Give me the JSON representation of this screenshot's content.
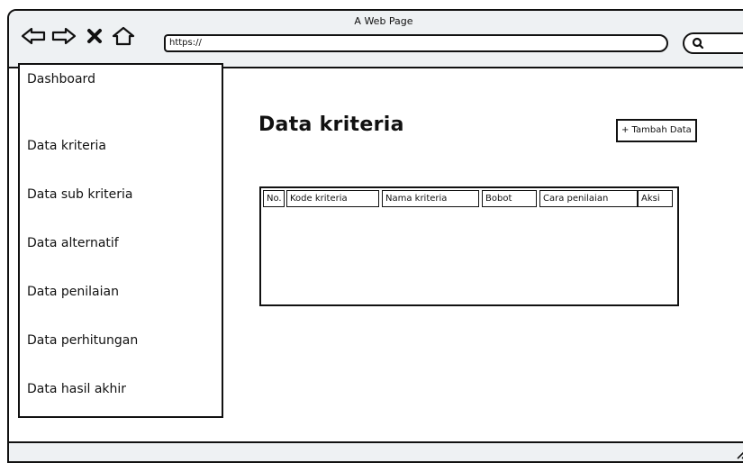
{
  "browser": {
    "title": "A Web Page",
    "url": "https://",
    "icons": [
      "back-arrow-icon",
      "forward-arrow-icon",
      "close-icon",
      "home-icon",
      "search-icon"
    ]
  },
  "sidebar": {
    "items": [
      {
        "label": "Dashboard"
      },
      {
        "label": "Data kriteria"
      },
      {
        "label": "Data sub kriteria"
      },
      {
        "label": "Data alternatif"
      },
      {
        "label": "Data penilaian"
      },
      {
        "label": "Data perhitungan"
      },
      {
        "label": "Data hasil akhir"
      }
    ]
  },
  "main": {
    "title": "Data kriteria",
    "add_button": "+ Tambah Data",
    "table": {
      "headers": [
        "No.",
        "Kode kriteria",
        "Nama kriteria",
        "Bobot",
        "Cara penilaian",
        "Aksi"
      ]
    }
  }
}
